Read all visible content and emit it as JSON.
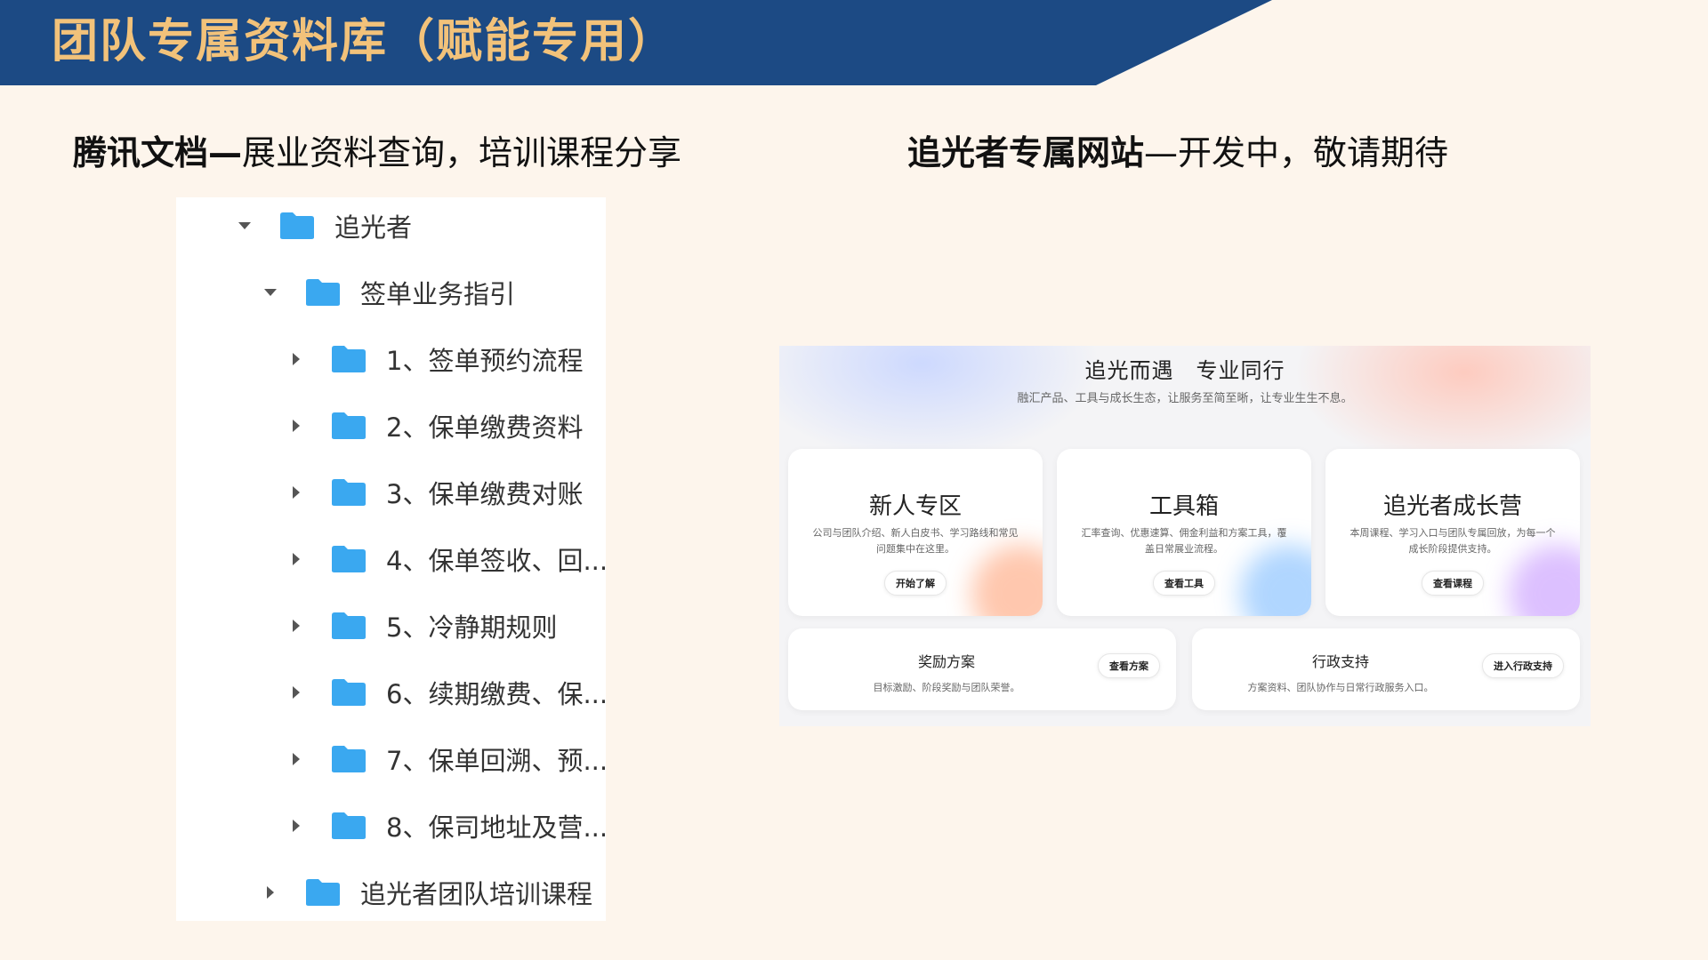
{
  "banner": {
    "title": "团队专属资料库（赋能专用）",
    "color_bg": "#1c4a84",
    "color_title": "#f2c27a"
  },
  "left_section": {
    "heading_bold": "腾讯文档—",
    "heading_rest": "展业资料查询，培训课程分享"
  },
  "right_section": {
    "heading_bold": "追光者专属网站",
    "heading_rest": "—开发中，敬请期待"
  },
  "tree": {
    "items": [
      {
        "label": "追光者",
        "expanded": true,
        "level": 0
      },
      {
        "label": "签单业务指引",
        "expanded": true,
        "level": 1
      },
      {
        "label": "1、签单预约流程",
        "expanded": false,
        "level": 2
      },
      {
        "label": "2、保单缴费资料",
        "expanded": false,
        "level": 2
      },
      {
        "label": "3、保单缴费对账",
        "expanded": false,
        "level": 2
      },
      {
        "label": "4、保单签收、回...",
        "expanded": false,
        "level": 2
      },
      {
        "label": "5、冷静期规则",
        "expanded": false,
        "level": 2
      },
      {
        "label": "6、续期缴费、保...",
        "expanded": false,
        "level": 2
      },
      {
        "label": "7、保单回溯、预...",
        "expanded": false,
        "level": 2
      },
      {
        "label": "8、保司地址及营...",
        "expanded": false,
        "level": 2
      },
      {
        "label": "追光者团队培训课程",
        "expanded": false,
        "level": 1
      }
    ],
    "folder_color": "#3aa8f0"
  },
  "site": {
    "title": "追光而遇　专业同行",
    "subtitle": "融汇产品、工具与成长生态，让服务至简至晰，让专业生生不息。",
    "cards": [
      {
        "title": "新人专区",
        "desc": "公司与团队介绍、新人白皮书、学习路线和常见问题集中在这里。",
        "button": "开始了解",
        "glow": "#ff9a6c"
      },
      {
        "title": "工具箱",
        "desc": "汇率查询、优惠速算、佣金利益和方案工具，覆盖日常展业流程。",
        "button": "查看工具",
        "glow": "#6fb4ff"
      },
      {
        "title": "追光者成长营",
        "desc": "本周课程、学习入口与团队专属回放，为每一个成长阶段提供支持。",
        "button": "查看课程",
        "glow": "#c08cff"
      }
    ],
    "wide_cards": [
      {
        "title": "奖励方案",
        "desc": "目标激励、阶段奖励与团队荣誉。",
        "button": "查看方案"
      },
      {
        "title": "行政支持",
        "desc": "方案资料、团队协作与日常行政服务入口。",
        "button": "进入行政支持"
      }
    ]
  }
}
